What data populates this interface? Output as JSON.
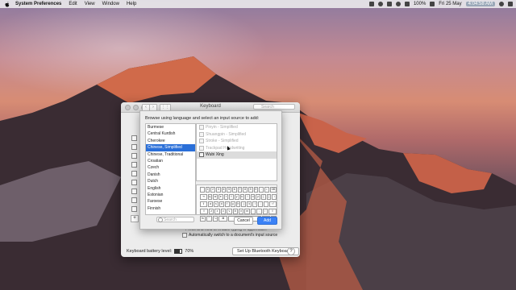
{
  "menubar": {
    "app_name": "System Preferences",
    "menus": [
      "Edit",
      "View",
      "Window",
      "Help"
    ],
    "battery": "100%",
    "date_time": "Fri 25 May",
    "clock": "4:04:58 AM"
  },
  "keyboard_window": {
    "title": "Keyboard",
    "search_placeholder": "Search",
    "hint_text": "Press and hold to enable typing in uppercase.",
    "auto_switch_label": "Automatically switch to a document's input source",
    "battery_label": "Keyboard battery level:",
    "battery_level": "70%",
    "battery_fraction": 0.7,
    "setup_button": "Set Up Bluetooth Keyboard...",
    "help_button": "?",
    "add_button": "+"
  },
  "sheet": {
    "prompt": "Browse using language and select an input source to add:",
    "languages": [
      "Burmese",
      "Central Kurdish",
      "Cherokee",
      "Chinese, Simplified",
      "Chinese, Traditional",
      "Croatian",
      "Czech",
      "Danish",
      "Dutch",
      "English",
      "Estonian",
      "Faroese",
      "Finnish"
    ],
    "selected_language": "Chinese, Simplified",
    "sources": [
      {
        "label": "Pinyin - Simplified",
        "selected": false
      },
      {
        "label": "Shuangpin - Simplified",
        "selected": false
      },
      {
        "label": "Stroke - Simplified",
        "selected": false
      },
      {
        "label": "Trackpad Handwriting",
        "selected": false
      },
      {
        "label": "Wubi Xing",
        "selected": true
      }
    ],
    "search_placeholder": "Search",
    "cancel_button": "Cancel",
    "add_button": "Add"
  }
}
